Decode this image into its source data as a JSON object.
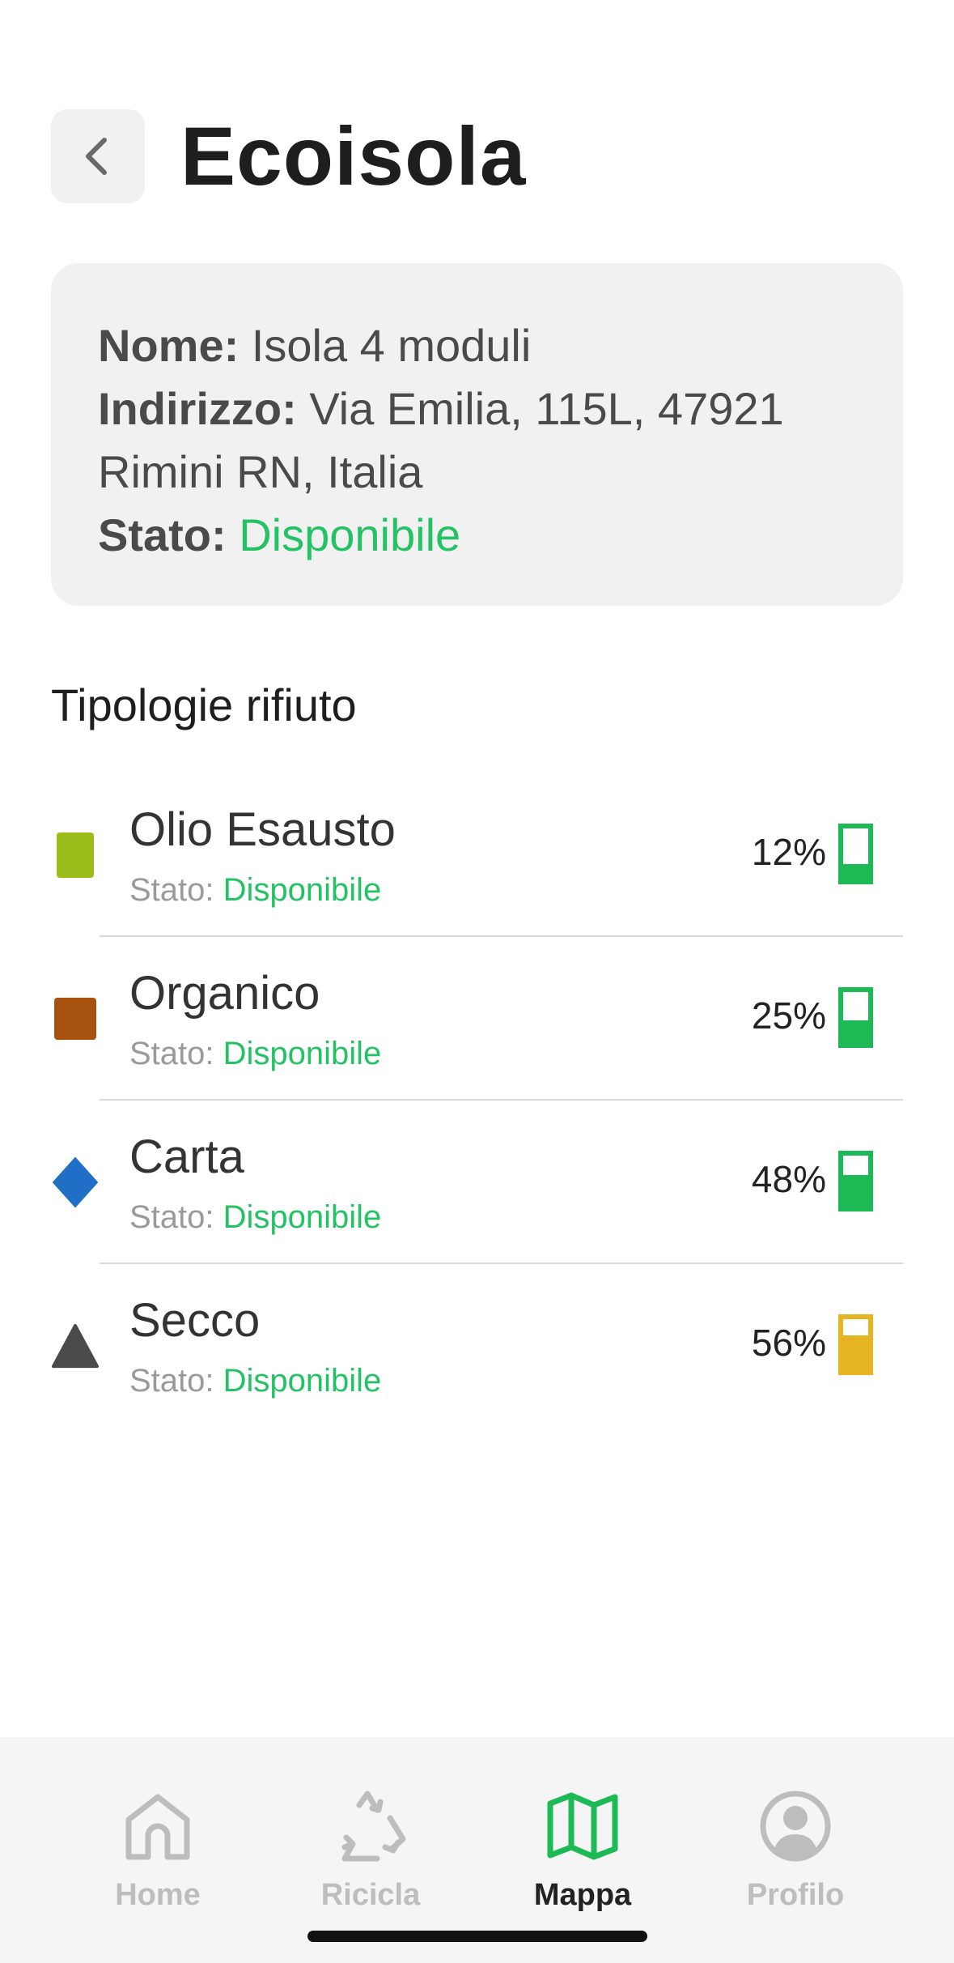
{
  "header": {
    "back_icon": "chevron-left-icon",
    "title": "Ecoisola"
  },
  "info": {
    "name_label": "Nome:",
    "name_value": "Isola 4 moduli",
    "address_label": "Indirizzo:",
    "address_value": "Via Emilia, 115L, 47921 Rimini RN, Italia",
    "status_label": "Stato:",
    "status_value": "Disponibile",
    "status_color": "#25c265"
  },
  "section_title": "Tipologie rifiuto",
  "waste_types": [
    {
      "name": "Olio Esausto",
      "status_label": "Stato:",
      "status_value": "Disponibile",
      "percent": "12%",
      "fill_fraction": 0.3,
      "marker": "square",
      "marker_color": "#9bbd1a",
      "bin_color": "#1db954"
    },
    {
      "name": "Organico",
      "status_label": "Stato:",
      "status_value": "Disponibile",
      "percent": "25%",
      "fill_fraction": 0.45,
      "marker": "square",
      "marker_color": "#a8520f",
      "bin_color": "#1db954"
    },
    {
      "name": "Carta",
      "status_label": "Stato:",
      "status_value": "Disponibile",
      "percent": "48%",
      "fill_fraction": 0.62,
      "marker": "diamond",
      "marker_color": "#1f6fc6",
      "bin_color": "#1db954"
    },
    {
      "name": "Secco",
      "status_label": "Stato:",
      "status_value": "Disponibile",
      "percent": "56%",
      "fill_fraction": 0.68,
      "marker": "triangle",
      "marker_color": "#4a4a4a",
      "bin_color": "#e6b422"
    }
  ],
  "tabbar": {
    "tabs": [
      {
        "label": "Home",
        "icon": "home-icon",
        "active": false
      },
      {
        "label": "Ricicla",
        "icon": "recycle-icon",
        "active": false
      },
      {
        "label": "Mappa",
        "icon": "map-icon",
        "active": true
      },
      {
        "label": "Profilo",
        "icon": "profile-icon",
        "active": false
      }
    ],
    "active_color": "#1db954",
    "inactive_color": "#bdbdbd"
  }
}
